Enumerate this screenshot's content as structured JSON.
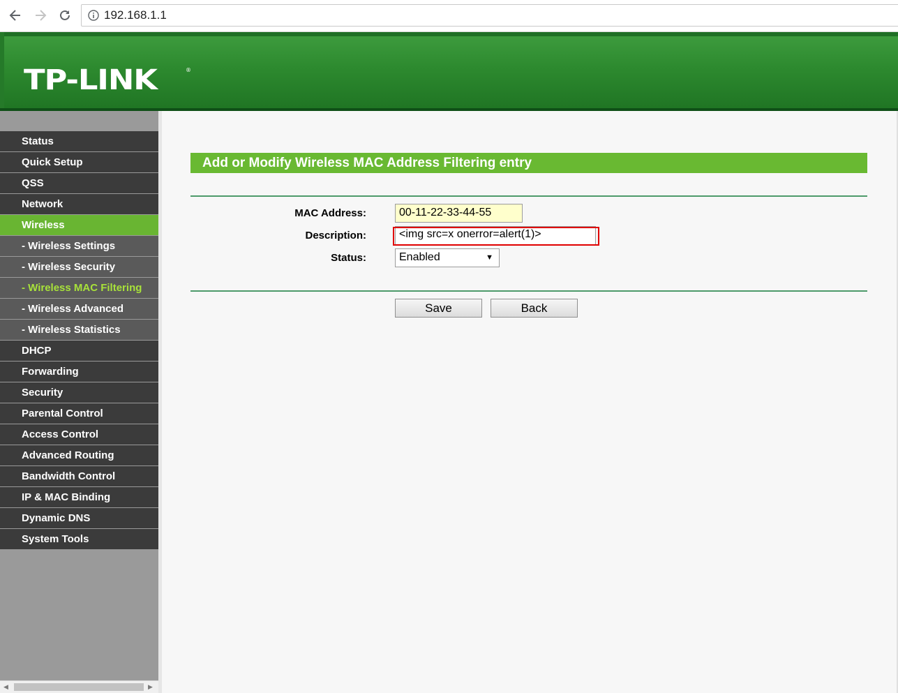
{
  "browser": {
    "url": "192.168.1.1"
  },
  "brand": {
    "logo_text": "TP-LINK",
    "registered": "®"
  },
  "sidebar": {
    "items": [
      {
        "label": "Status"
      },
      {
        "label": "Quick Setup"
      },
      {
        "label": "QSS"
      },
      {
        "label": "Network"
      },
      {
        "label": "Wireless",
        "state": "active"
      },
      {
        "label": "- Wireless Settings"
      },
      {
        "label": "- Wireless Security"
      },
      {
        "label": "- Wireless MAC Filtering",
        "state": "current"
      },
      {
        "label": "- Wireless Advanced"
      },
      {
        "label": "- Wireless Statistics"
      },
      {
        "label": "DHCP"
      },
      {
        "label": "Forwarding"
      },
      {
        "label": "Security"
      },
      {
        "label": "Parental Control"
      },
      {
        "label": "Access Control"
      },
      {
        "label": "Advanced Routing"
      },
      {
        "label": "Bandwidth Control"
      },
      {
        "label": "IP & MAC Binding"
      },
      {
        "label": "Dynamic DNS"
      },
      {
        "label": "System Tools"
      }
    ]
  },
  "main": {
    "title": "Add or Modify Wireless MAC Address Filtering entry",
    "form": {
      "mac_label": "MAC Address:",
      "mac_value": "00-11-22-33-44-55",
      "description_label": "Description:",
      "description_value": "<img src=x onerror=alert(1)>",
      "status_label": "Status:",
      "status_value": "Enabled"
    },
    "buttons": {
      "save": "Save",
      "back": "Back"
    }
  },
  "colors": {
    "accent_green": "#69b932",
    "highlight_red": "#e00000",
    "menu_dark": "#3b3b3b"
  }
}
